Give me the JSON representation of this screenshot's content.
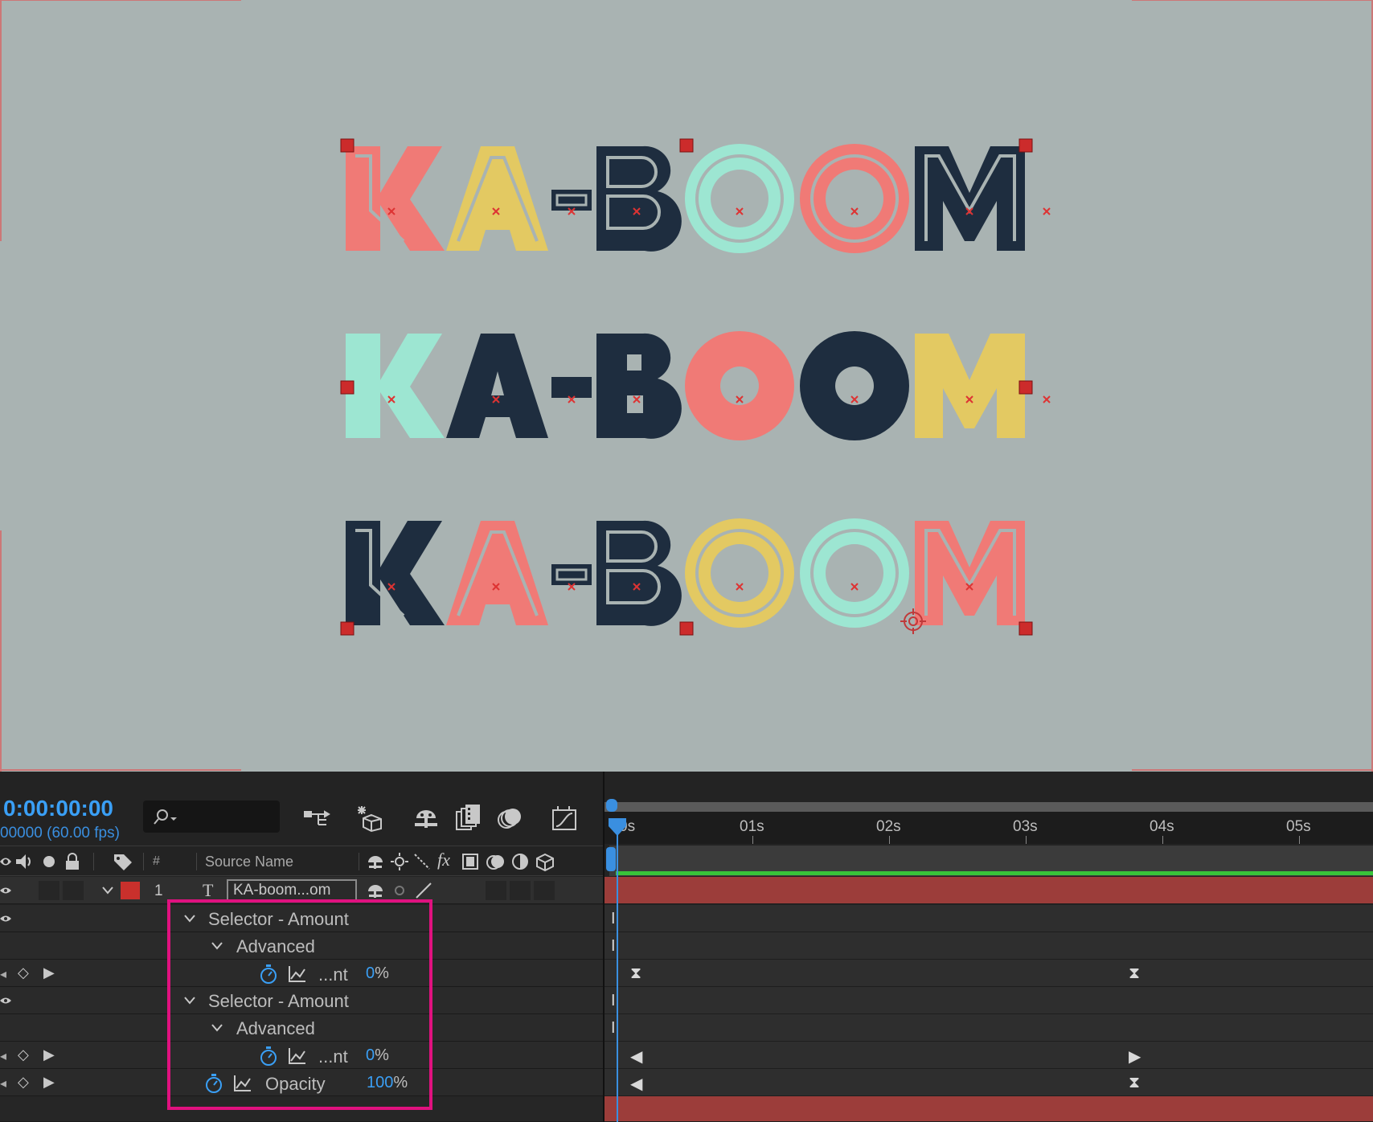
{
  "composition": {
    "lines": [
      {
        "text": "KA-BOOM",
        "style": "outline"
      },
      {
        "text": "KA-BOOM",
        "style": "solid"
      },
      {
        "text": "KA-BOOM",
        "style": "outline"
      }
    ],
    "colors": {
      "background": "#a9b3b2",
      "coral": "#f07a76",
      "yellow": "#e3c962",
      "mint": "#9de6d2",
      "navy": "#1e2d3f",
      "handle": "#cc2b2b"
    }
  },
  "timeline": {
    "timecode": "0:00:00:00",
    "fps_label": "00000 (60.00 fps)",
    "search_icon": "search-icon",
    "toolbar_icons": [
      "comp-flowchart-icon",
      "draft-3d-icon",
      "shy-layers-icon",
      "frame-blending-icon",
      "motion-blur-icon",
      "graph-editor-icon"
    ],
    "columns": {
      "number": "#",
      "source_name": "Source Name"
    },
    "layer": {
      "number": "1",
      "type_icon": "T",
      "name": "KA-boom...om",
      "label_color": "#c9302c"
    },
    "properties": [
      {
        "label": "Selector - Amount",
        "kind": "group"
      },
      {
        "label": "Advanced",
        "kind": "group"
      },
      {
        "label": "...nt",
        "value": "0",
        "unit": "%"
      },
      {
        "label": "Selector - Amount",
        "kind": "group"
      },
      {
        "label": "Advanced",
        "kind": "group"
      },
      {
        "label": "...nt",
        "value": "0",
        "unit": "%"
      },
      {
        "label": "Opacity",
        "value": "100",
        "unit": "%"
      }
    ],
    "ruler_ticks": [
      "0s",
      "01s",
      "02s",
      "03s",
      "04s",
      "05s"
    ],
    "colors": {
      "accent": "#3a9ff5",
      "highlight": "#e0117f",
      "work_area_green": "#38c43a",
      "layer_bar": "#9c3d3a"
    }
  }
}
